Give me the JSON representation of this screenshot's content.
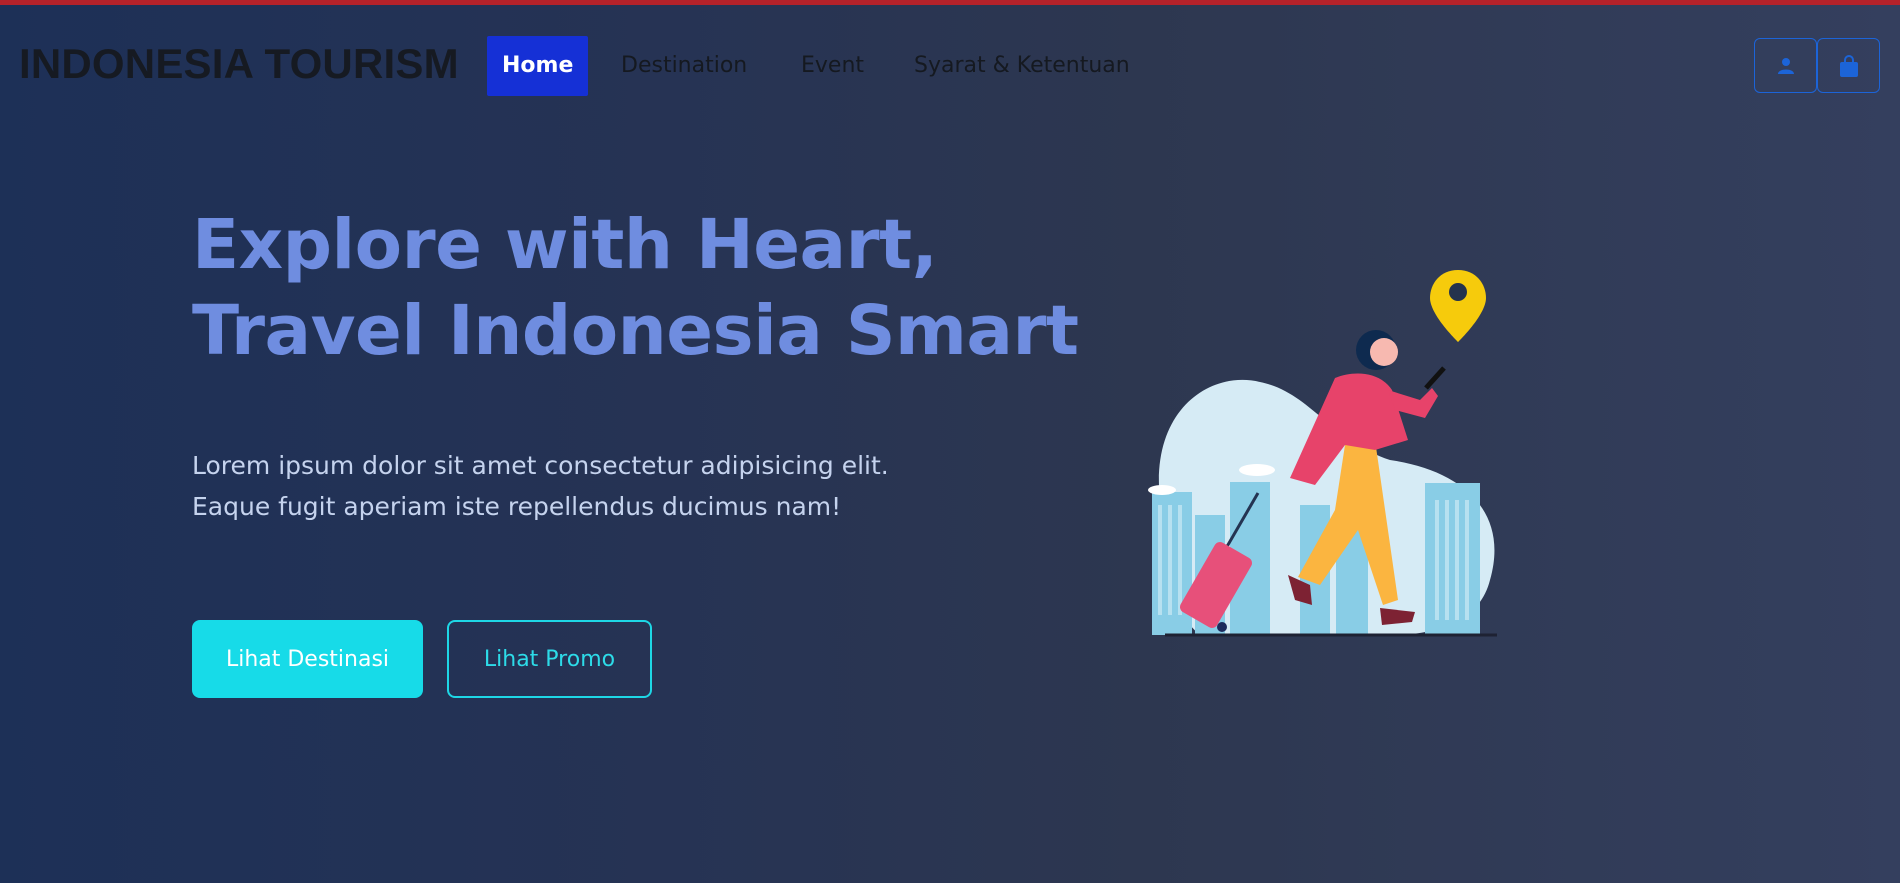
{
  "navbar": {
    "brand": "INDONESIA TOURISM",
    "links": [
      {
        "label": "Home",
        "active": true
      },
      {
        "label": "Destination",
        "active": false
      },
      {
        "label": "Event",
        "active": false
      },
      {
        "label": "Syarat & Ketentuan",
        "active": false
      }
    ],
    "icons": [
      "user-icon",
      "shopping-bag-icon"
    ]
  },
  "hero": {
    "headline_line1": "Explore with Heart,",
    "headline_line2": "Travel Indonesia Smart",
    "lead": "Lorem ipsum dolor sit amet consectetur adipisicing elit. Eaque fugit aperiam iste repellendus ducimus nam!",
    "primary_button": "Lihat Destinasi",
    "secondary_button": "Lihat Promo",
    "illustration": "traveler-with-suitcase-illustration"
  },
  "colors": {
    "accent_nav": "#1530d6",
    "headline": "#6f8de0",
    "cta": "#17dbe8",
    "icon_blue": "#1c64d8"
  }
}
